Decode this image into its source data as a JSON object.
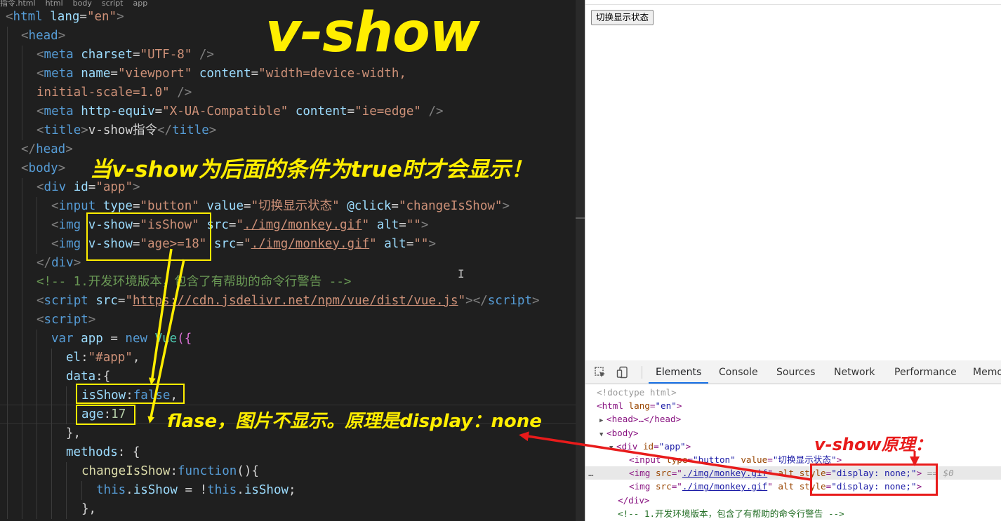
{
  "breadcrumb": {
    "file": "指令.html",
    "items": [
      "html",
      "body",
      "script",
      "app"
    ]
  },
  "code": {
    "l1_tag": "html",
    "l1_attr": "lang",
    "l1_val": "\"en\"",
    "l2_tag": "head",
    "l3_tag": "meta",
    "l3_attr": "charset",
    "l3_val": "\"UTF-8\"",
    "l4_tag": "meta",
    "l4_attr1": "name",
    "l4_val1": "\"viewport\"",
    "l4_attr2": "content",
    "l4_val2": "\"width=device-width,",
    "l5_val": "initial-scale=1.0\"",
    "l6_tag": "meta",
    "l6_attr1": "http-equiv",
    "l6_val1": "\"X-UA-Compatible\"",
    "l6_attr2": "content",
    "l6_val2": "\"ie=edge\"",
    "l7_tag": "title",
    "l7_text": "v-show指令",
    "l8_tag": "head",
    "l9_tag": "body",
    "l10_tag": "div",
    "l10_attr": "id",
    "l10_val": "\"app\"",
    "l11_tag": "input",
    "l11_attr1": "type",
    "l11_val1": "\"button\"",
    "l11_attr2": "value",
    "l11_val2": "\"切换显示状态\"",
    "l11_attr3": "@click",
    "l11_val3": "\"changeIsShow\"",
    "l12_tag": "img",
    "l12_attr1": "v-show",
    "l12_val1": "\"isShow\"",
    "l12_attr2": "src",
    "l12_q1": "\"",
    "l12_link": "./img/monkey.gif",
    "l12_q2": "\"",
    "l12_attr3": "alt",
    "l12_val3": "\"\"",
    "l13_tag": "img",
    "l13_attr1": "v-show",
    "l13_val1a": "\"age",
    "l13_val1b": ">=18\"",
    "l13_attr2": "src",
    "l13_q1": "\"",
    "l13_link": "./img/monkey.gif",
    "l13_q2": "\"",
    "l13_attr3": "alt",
    "l13_val3": "\"\"",
    "l14_tag": "div",
    "l15_comment": "<!-- 1.开发环境版本，包含了有帮助的命令行警告 -->",
    "l16_tag": "script",
    "l16_attr": "src",
    "l16_q1": "\"",
    "l16_link": "https://cdn.jsdelivr.net/npm/vue/dist/vue.js",
    "l16_q2": "\"",
    "l17_tag": "script",
    "l18_kw1": "var",
    "l18_var": "app",
    "l18_eq": "=",
    "l18_kw2": "new",
    "l18_cls": "Vue",
    "l19_key": "el",
    "l19_val": "\"#app\"",
    "l20_key": "data",
    "l21_key": "isShow",
    "l21_val": "false",
    "l22_key": "age",
    "l22_val": "17",
    "l24_key": "methods",
    "l25_fn": "changeIsShow",
    "l25_kw": "function",
    "l26_this1": "this",
    "l26_prop1": "isShow",
    "l26_eq": "=",
    "l26_not": "!",
    "l26_this2": "this",
    "l26_prop2": "isShow"
  },
  "browser": {
    "toggle_button": "切换显示状态"
  },
  "devtools": {
    "tabs": [
      "Elements",
      "Console",
      "Sources",
      "Network",
      "Performance",
      "Memo"
    ],
    "dom": {
      "doctype": "<!doctype html>",
      "html_tag": "html",
      "html_attr": "lang",
      "html_val": "\"en\"",
      "head_collapsed": "<head>…</head>",
      "body_tag": "body",
      "div_tag": "div",
      "div_attr": "id",
      "div_val": "\"app\"",
      "input_tag": "input",
      "input_attr1": "type",
      "input_val1": "\"button\"",
      "input_attr2": "value",
      "input_val2": "\"切换显示状态\"",
      "img_tag": "img",
      "img_attr_src": "src",
      "img_src": "./img/monkey.gif",
      "img_attr_alt": "alt",
      "img_attr_style": "style",
      "img_style": "\"display: none;\"",
      "eq0": "== $0",
      "div_close": "</div>",
      "comment": "<!-- 1.开发环境版本，包含了有帮助的命令行警告 -->"
    }
  },
  "annotations": {
    "title": "v-show",
    "condition": "当v-show为后面的条件为true时才会显示！",
    "false_note": "flase，图片不显示。原理是display：none",
    "principle": "v-show原理："
  },
  "colors": {
    "annotation_yellow": "#ffee00",
    "annotation_red": "#e81b1b",
    "tab_active": "#1a73e8"
  }
}
